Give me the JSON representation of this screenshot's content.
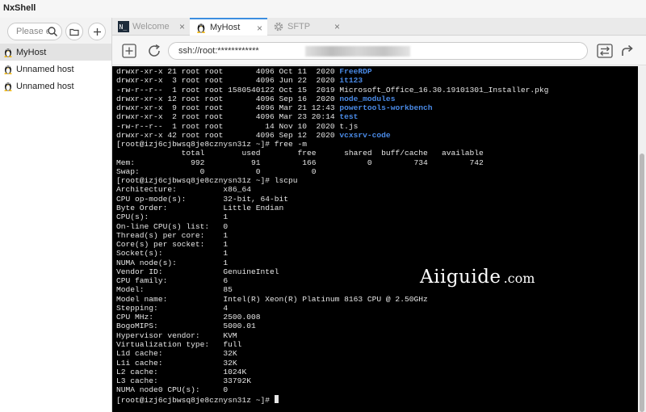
{
  "app": {
    "title": "NxShell"
  },
  "sidebar": {
    "search_placeholder": "Please en",
    "hosts": [
      {
        "label": "MyHost",
        "active": true
      },
      {
        "label": "Unnamed host",
        "active": false
      },
      {
        "label": "Unnamed host",
        "active": false
      }
    ]
  },
  "tabs": [
    {
      "label": "Welcome",
      "icon": "terminal-icon",
      "active": false
    },
    {
      "label": "MyHost",
      "icon": "tux-icon",
      "active": true
    },
    {
      "label": "SFTP",
      "icon": "gear-icon",
      "active": false
    }
  ],
  "tab_close_glyph": "×",
  "address": {
    "value": "ssh://root:************"
  },
  "terminal": {
    "lines": [
      [
        {
          "t": "drwxr-xr-x 21 root root       4096 Oct 11  2020 "
        },
        {
          "t": "FreeRDP",
          "c": "blue"
        }
      ],
      [
        {
          "t": "drwxr-xr-x  3 root root       4096 Jun 22  2020 "
        },
        {
          "t": "it123",
          "c": "blue"
        }
      ],
      [
        {
          "t": "-rw-r--r--  1 root root 1580540122 Oct 15  2019 Microsoft_Office_16.30.19101301_Installer.pkg"
        }
      ],
      [
        {
          "t": "drwxr-xr-x 12 root root       4096 Sep 16  2020 "
        },
        {
          "t": "node_modules",
          "c": "blue"
        }
      ],
      [
        {
          "t": "drwxr-xr-x  9 root root       4096 Mar 21 12:43 "
        },
        {
          "t": "powertools-workbench",
          "c": "blue"
        }
      ],
      [
        {
          "t": "drwxr-xr-x  2 root root       4096 Mar 23 20:14 "
        },
        {
          "t": "test",
          "c": "blue"
        }
      ],
      [
        {
          "t": "-rw-r--r--  1 root root         14 Nov 10  2020 t.js"
        }
      ],
      [
        {
          "t": "drwxr-xr-x 42 root root       4096 Sep 12  2020 "
        },
        {
          "t": "vcxsrv-code",
          "c": "blue"
        }
      ],
      [
        {
          "t": "[root@izj6cjbwsq8je8cznysn31z ~]# free -m"
        }
      ],
      [
        {
          "t": "              total        used        free      shared  buff/cache   available"
        }
      ],
      [
        {
          "t": "Mem:            992          91         166           0         734         742"
        }
      ],
      [
        {
          "t": "Swap:             0           0           0"
        }
      ],
      [
        {
          "t": "[root@izj6cjbwsq8je8cznysn31z ~]# lscpu"
        }
      ],
      [
        {
          "t": "Architecture:          x86_64"
        }
      ],
      [
        {
          "t": "CPU op-mode(s):        32-bit, 64-bit"
        }
      ],
      [
        {
          "t": "Byte Order:            Little Endian"
        }
      ],
      [
        {
          "t": "CPU(s):                1"
        }
      ],
      [
        {
          "t": "On-line CPU(s) list:   0"
        }
      ],
      [
        {
          "t": "Thread(s) per core:    1"
        }
      ],
      [
        {
          "t": "Core(s) per socket:    1"
        }
      ],
      [
        {
          "t": "Socket(s):             1"
        }
      ],
      [
        {
          "t": "NUMA node(s):          1"
        }
      ],
      [
        {
          "t": "Vendor ID:             GenuineIntel"
        }
      ],
      [
        {
          "t": "CPU family:            6"
        }
      ],
      [
        {
          "t": "Model:                 85"
        }
      ],
      [
        {
          "t": "Model name:            Intel(R) Xeon(R) Platinum 8163 CPU @ 2.50GHz"
        }
      ],
      [
        {
          "t": "Stepping:              4"
        }
      ],
      [
        {
          "t": "CPU MHz:               2500.008"
        }
      ],
      [
        {
          "t": "BogoMIPS:              5000.01"
        }
      ],
      [
        {
          "t": "Hypervisor vendor:     KVM"
        }
      ],
      [
        {
          "t": "Virtualization type:   full"
        }
      ],
      [
        {
          "t": "L1d cache:             32K"
        }
      ],
      [
        {
          "t": "L1i cache:             32K"
        }
      ],
      [
        {
          "t": "L2 cache:              1024K"
        }
      ],
      [
        {
          "t": "L3 cache:              33792K"
        }
      ],
      [
        {
          "t": "NUMA node0 CPU(s):     0"
        }
      ],
      [
        {
          "t": "[root@izj6cjbwsq8je8cznysn31z ~]# "
        }
      ]
    ]
  },
  "watermark": {
    "main": "Aiiguide",
    "tld": ".com"
  },
  "colors": {
    "dir": "#4a8be8",
    "terminal_bg": "#000000",
    "terminal_fg": "#e6e6e6",
    "active_tab_accent": "#3c8ee0"
  }
}
